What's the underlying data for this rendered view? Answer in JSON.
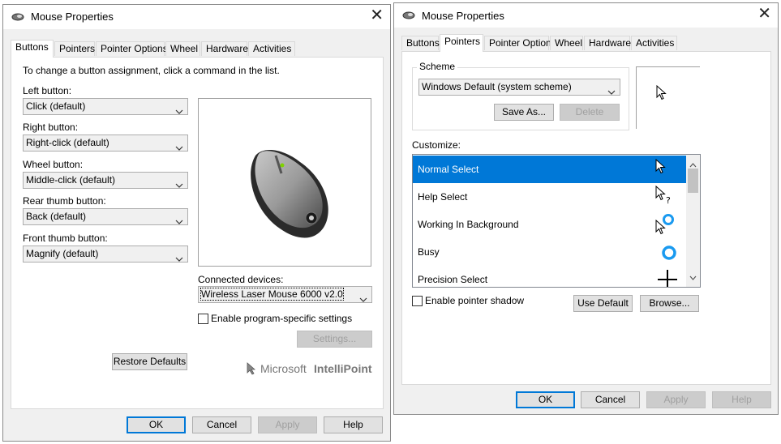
{
  "left_window": {
    "title": "Mouse Properties",
    "tabs": [
      "Buttons",
      "Pointers",
      "Pointer Options",
      "Wheel",
      "Hardware",
      "Activities"
    ],
    "instruction": "To change a button assignment, click a command in the list.",
    "fields": [
      {
        "label": "Left button:",
        "value": "Click (default)"
      },
      {
        "label": "Right button:",
        "value": "Right-click (default)"
      },
      {
        "label": "Wheel button:",
        "value": "Middle-click (default)"
      },
      {
        "label": "Rear thumb button:",
        "value": "Back (default)"
      },
      {
        "label": "Front thumb button:",
        "value": "Magnify (default)"
      }
    ],
    "connected_label": "Connected devices:",
    "connected_value": "Wireless Laser Mouse 6000 v2.0",
    "enable_label": "Enable program-specific settings",
    "settings_button": "Settings...",
    "restore_button": "Restore Defaults",
    "logo_ms": "Microsoft",
    "logo_ip": "IntelliPoint",
    "footer": {
      "ok": "OK",
      "cancel": "Cancel",
      "apply": "Apply",
      "help": "Help"
    }
  },
  "right_window": {
    "title": "Mouse Properties",
    "tabs": [
      "Buttons",
      "Pointers",
      "Pointer Options",
      "Wheel",
      "Hardware",
      "Activities"
    ],
    "scheme_label": "Scheme",
    "scheme_value": "Windows Default (system scheme)",
    "save_as": "Save As...",
    "delete": "Delete",
    "customize_label": "Customize:",
    "cursors": [
      {
        "name": "Normal Select",
        "icon": "arrow-cursor-icon"
      },
      {
        "name": "Help Select",
        "icon": "help-cursor-icon"
      },
      {
        "name": "Working In Background",
        "icon": "working-cursor-icon"
      },
      {
        "name": "Busy",
        "icon": "busy-cursor-icon"
      },
      {
        "name": "Precision Select",
        "icon": "crosshair-cursor-icon"
      }
    ],
    "pointer_shadow": "Enable pointer shadow",
    "use_default": "Use Default",
    "browse": "Browse...",
    "footer": {
      "ok": "OK",
      "cancel": "Cancel",
      "apply": "Apply",
      "help": "Help"
    }
  }
}
